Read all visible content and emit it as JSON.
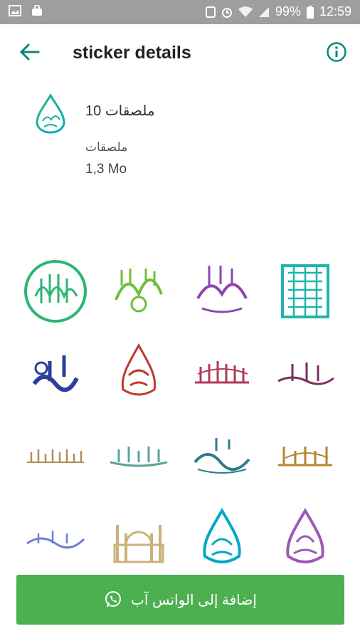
{
  "status_bar": {
    "battery": "99%",
    "time": "12:59"
  },
  "header": {
    "title": "sticker details"
  },
  "pack": {
    "name": "10 ملصقات",
    "publisher": "ملصقات",
    "size": "1,3 Mo"
  },
  "stickers": [
    {
      "icon": "calligraphy-circle-green"
    },
    {
      "icon": "calligraphy-eid-mubarak"
    },
    {
      "icon": "calligraphy-quran-pink"
    },
    {
      "icon": "calligraphy-kufic-square"
    },
    {
      "icon": "calligraphy-muhammad-blue"
    },
    {
      "icon": "calligraphy-bismillah-red"
    },
    {
      "icon": "calligraphy-shahada-pink"
    },
    {
      "icon": "calligraphy-subhanallah"
    },
    {
      "icon": "calligraphy-line-gold"
    },
    {
      "icon": "calligraphy-line-teal"
    },
    {
      "icon": "calligraphy-saeed"
    },
    {
      "icon": "calligraphy-quran-kareem"
    },
    {
      "icon": "calligraphy-line-blue"
    },
    {
      "icon": "mosque-silhouette"
    },
    {
      "icon": "calligraphy-teardrop-teal"
    },
    {
      "icon": "calligraphy-teardrop-purple"
    }
  ],
  "actions": {
    "add_label": "إضافة إلى الواتس آب"
  },
  "colors": {
    "accent": "#00897b",
    "button": "#4caf50",
    "statusbar": "#9e9e9e",
    "sticker_colors": [
      "#2bb673",
      "#6fbf3a",
      "#8e44ad",
      "#1fb5ad",
      "#2a3f9b",
      "#c0392b",
      "#b03a5b",
      "#7b2d5e",
      "#b08d57",
      "#5aa39a",
      "#2d7d8a",
      "#b5852e",
      "#6a7fd1",
      "#c9b27a",
      "#00a8c6",
      "#9b59b6"
    ]
  }
}
